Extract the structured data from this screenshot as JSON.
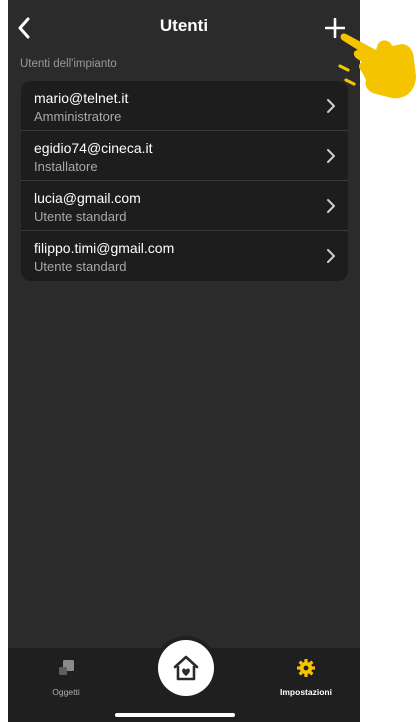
{
  "header": {
    "title": "Utenti",
    "back_icon": "chevron-left-icon",
    "add_icon": "plus-icon"
  },
  "section_label": "Utenti dell'impianto",
  "users": [
    {
      "email": "mario@telnet.it",
      "role": "Amministratore"
    },
    {
      "email": "egidio74@cineca.it",
      "role": "Installatore"
    },
    {
      "email": "lucia@gmail.com",
      "role": "Utente standard"
    },
    {
      "email": "filippo.timi@gmail.com",
      "role": "Utente standard"
    }
  ],
  "tabbar": {
    "objects_label": "Oggetti",
    "settings_label": "Impostazioni",
    "home_icon": "home-heart-icon"
  },
  "colors": {
    "background": "#2b2b2b",
    "card": "#1d1d1d",
    "accent": "#f5c400",
    "text": "#ffffff",
    "secondary_text": "#a9a9a9"
  }
}
